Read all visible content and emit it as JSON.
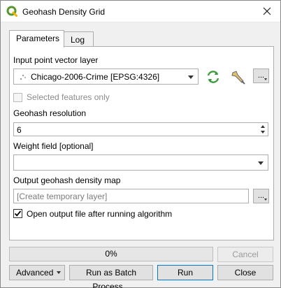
{
  "window": {
    "title": "Geohash Density Grid",
    "app_icon": "qgis-icon",
    "close_icon": "close-icon"
  },
  "tabs": [
    {
      "label": "Parameters",
      "active": true
    },
    {
      "label": "Log",
      "active": false
    }
  ],
  "params": {
    "input_layer": {
      "label": "Input point vector layer",
      "value": "Chicago-2006-Crime [EPSG:4326]",
      "layer_icon": "point-layer-icon",
      "iterate_icon": "iterate-icon",
      "settings_icon": "wrench-icon",
      "browse_label": "..."
    },
    "selected_only": {
      "label": "Selected features only",
      "checked": false,
      "enabled": false
    },
    "resolution": {
      "label": "Geohash resolution",
      "value": "6"
    },
    "weight": {
      "label": "Weight field [optional]",
      "value": ""
    },
    "output": {
      "label": "Output geohash density map",
      "placeholder": "[Create temporary layer]",
      "value": "",
      "browse_label": "..."
    },
    "open_output": {
      "label": "Open output file after running algorithm",
      "checked": true
    }
  },
  "progress": {
    "value": 0,
    "text": "0%"
  },
  "buttons": {
    "cancel": "Cancel",
    "advanced": "Advanced",
    "batch": "Run as Batch Process...",
    "run": "Run",
    "close": "Close"
  },
  "colors": {
    "accent": "#0078d7",
    "qgis_green": "#589632",
    "iterate_green": "#3a9c3a"
  }
}
